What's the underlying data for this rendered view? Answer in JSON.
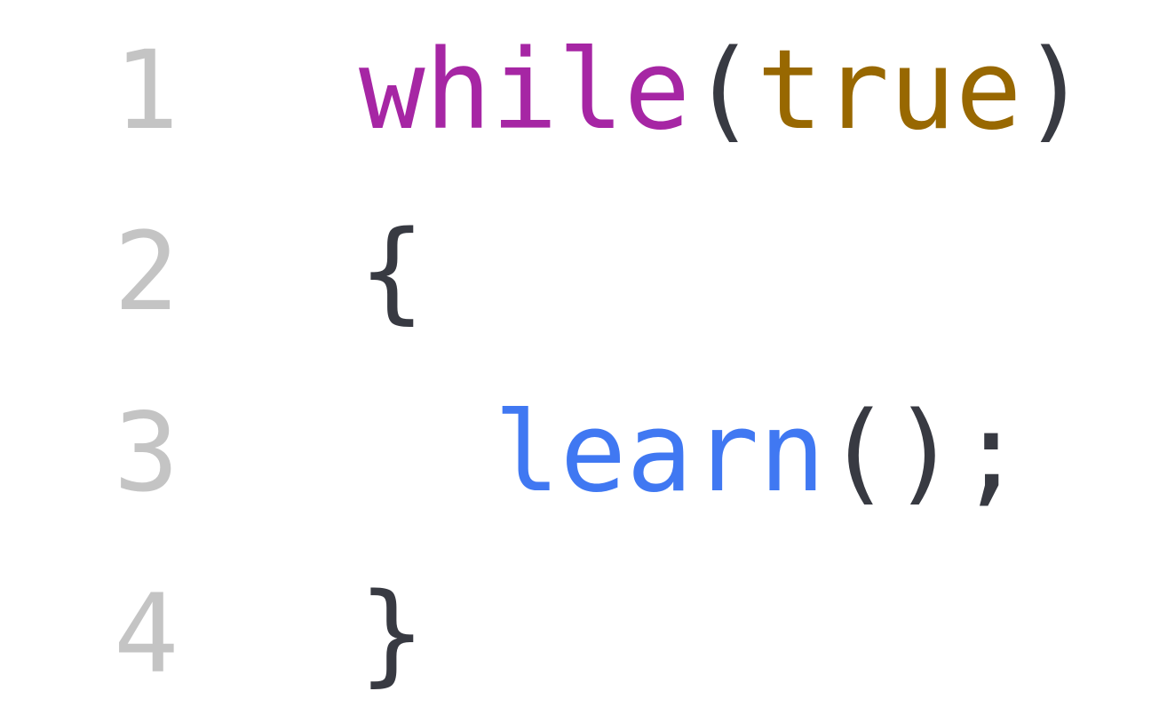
{
  "editor": {
    "colors": {
      "line_number": "#c4c4c4",
      "keyword": "#a626a4",
      "literal": "#986801",
      "function": "#4078f2",
      "punctuation": "#383a42",
      "background": "#ffffff"
    },
    "lines": [
      {
        "number": "1",
        "tokens": {
          "keyword": "while",
          "open_paren": "(",
          "literal": "true",
          "close_paren": ")"
        }
      },
      {
        "number": "2",
        "tokens": {
          "open_brace": "{"
        }
      },
      {
        "number": "3",
        "tokens": {
          "function": "learn",
          "call_parens": "()",
          "semicolon": ";"
        }
      },
      {
        "number": "4",
        "tokens": {
          "close_brace": "}"
        }
      }
    ]
  }
}
